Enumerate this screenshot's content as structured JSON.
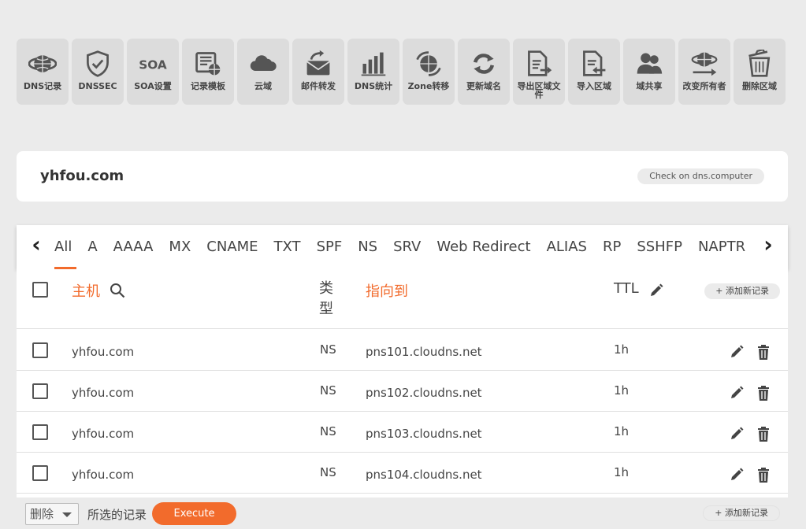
{
  "toolbar": {
    "items": [
      {
        "label": "DNS记录",
        "icon": "globe-icon"
      },
      {
        "label": "DNSSEC",
        "icon": "shield-check-icon"
      },
      {
        "label": "SOA设置",
        "icon": "soa-icon"
      },
      {
        "label": "记录模板",
        "icon": "template-icon"
      },
      {
        "label": "云域",
        "icon": "cloud-icon"
      },
      {
        "label": "邮件转发",
        "icon": "mail-forward-icon"
      },
      {
        "label": "DNS统计",
        "icon": "bar-chart-icon"
      },
      {
        "label": "Zone转移",
        "icon": "zone-transfer-icon"
      },
      {
        "label": "更新域名",
        "icon": "refresh-icon"
      },
      {
        "label": "导出区域文件",
        "icon": "export-file-icon"
      },
      {
        "label": "导入区域",
        "icon": "import-file-icon"
      },
      {
        "label": "域共享",
        "icon": "users-icon"
      },
      {
        "label": "改变所有者",
        "icon": "change-owner-icon"
      },
      {
        "label": "删除区域",
        "icon": "trash-icon"
      }
    ]
  },
  "domain": {
    "name": "yhfou.com",
    "check_label": "Check on dns.computer"
  },
  "tabs": {
    "items": [
      "All",
      "A",
      "AAAA",
      "MX",
      "CNAME",
      "TXT",
      "SPF",
      "NS",
      "SRV",
      "Web Redirect",
      "ALIAS",
      "RP",
      "SSHFP",
      "NAPTR"
    ],
    "active": "All",
    "prev_glyph": "‹",
    "next_glyph": "›"
  },
  "table": {
    "headers": {
      "host": "主机",
      "type": "类型",
      "points_to": "指向到",
      "ttl": "TTL"
    },
    "add_label": "+ 添加新记录",
    "rows": [
      {
        "host": "yhfou.com",
        "type": "NS",
        "value": "pns101.cloudns.net",
        "ttl": "1h"
      },
      {
        "host": "yhfou.com",
        "type": "NS",
        "value": "pns102.cloudns.net",
        "ttl": "1h"
      },
      {
        "host": "yhfou.com",
        "type": "NS",
        "value": "pns103.cloudns.net",
        "ttl": "1h"
      },
      {
        "host": "yhfou.com",
        "type": "NS",
        "value": "pns104.cloudns.net",
        "ttl": "1h"
      }
    ]
  },
  "footer": {
    "action_select": "删除",
    "selected_label": "所选的记录",
    "execute_label": "Execute",
    "add_label": "+ 添加新记录"
  },
  "colors": {
    "accent": "#f26b2c",
    "background": "#ebebeb",
    "tile": "#dcdcdc",
    "icon": "#555555"
  }
}
